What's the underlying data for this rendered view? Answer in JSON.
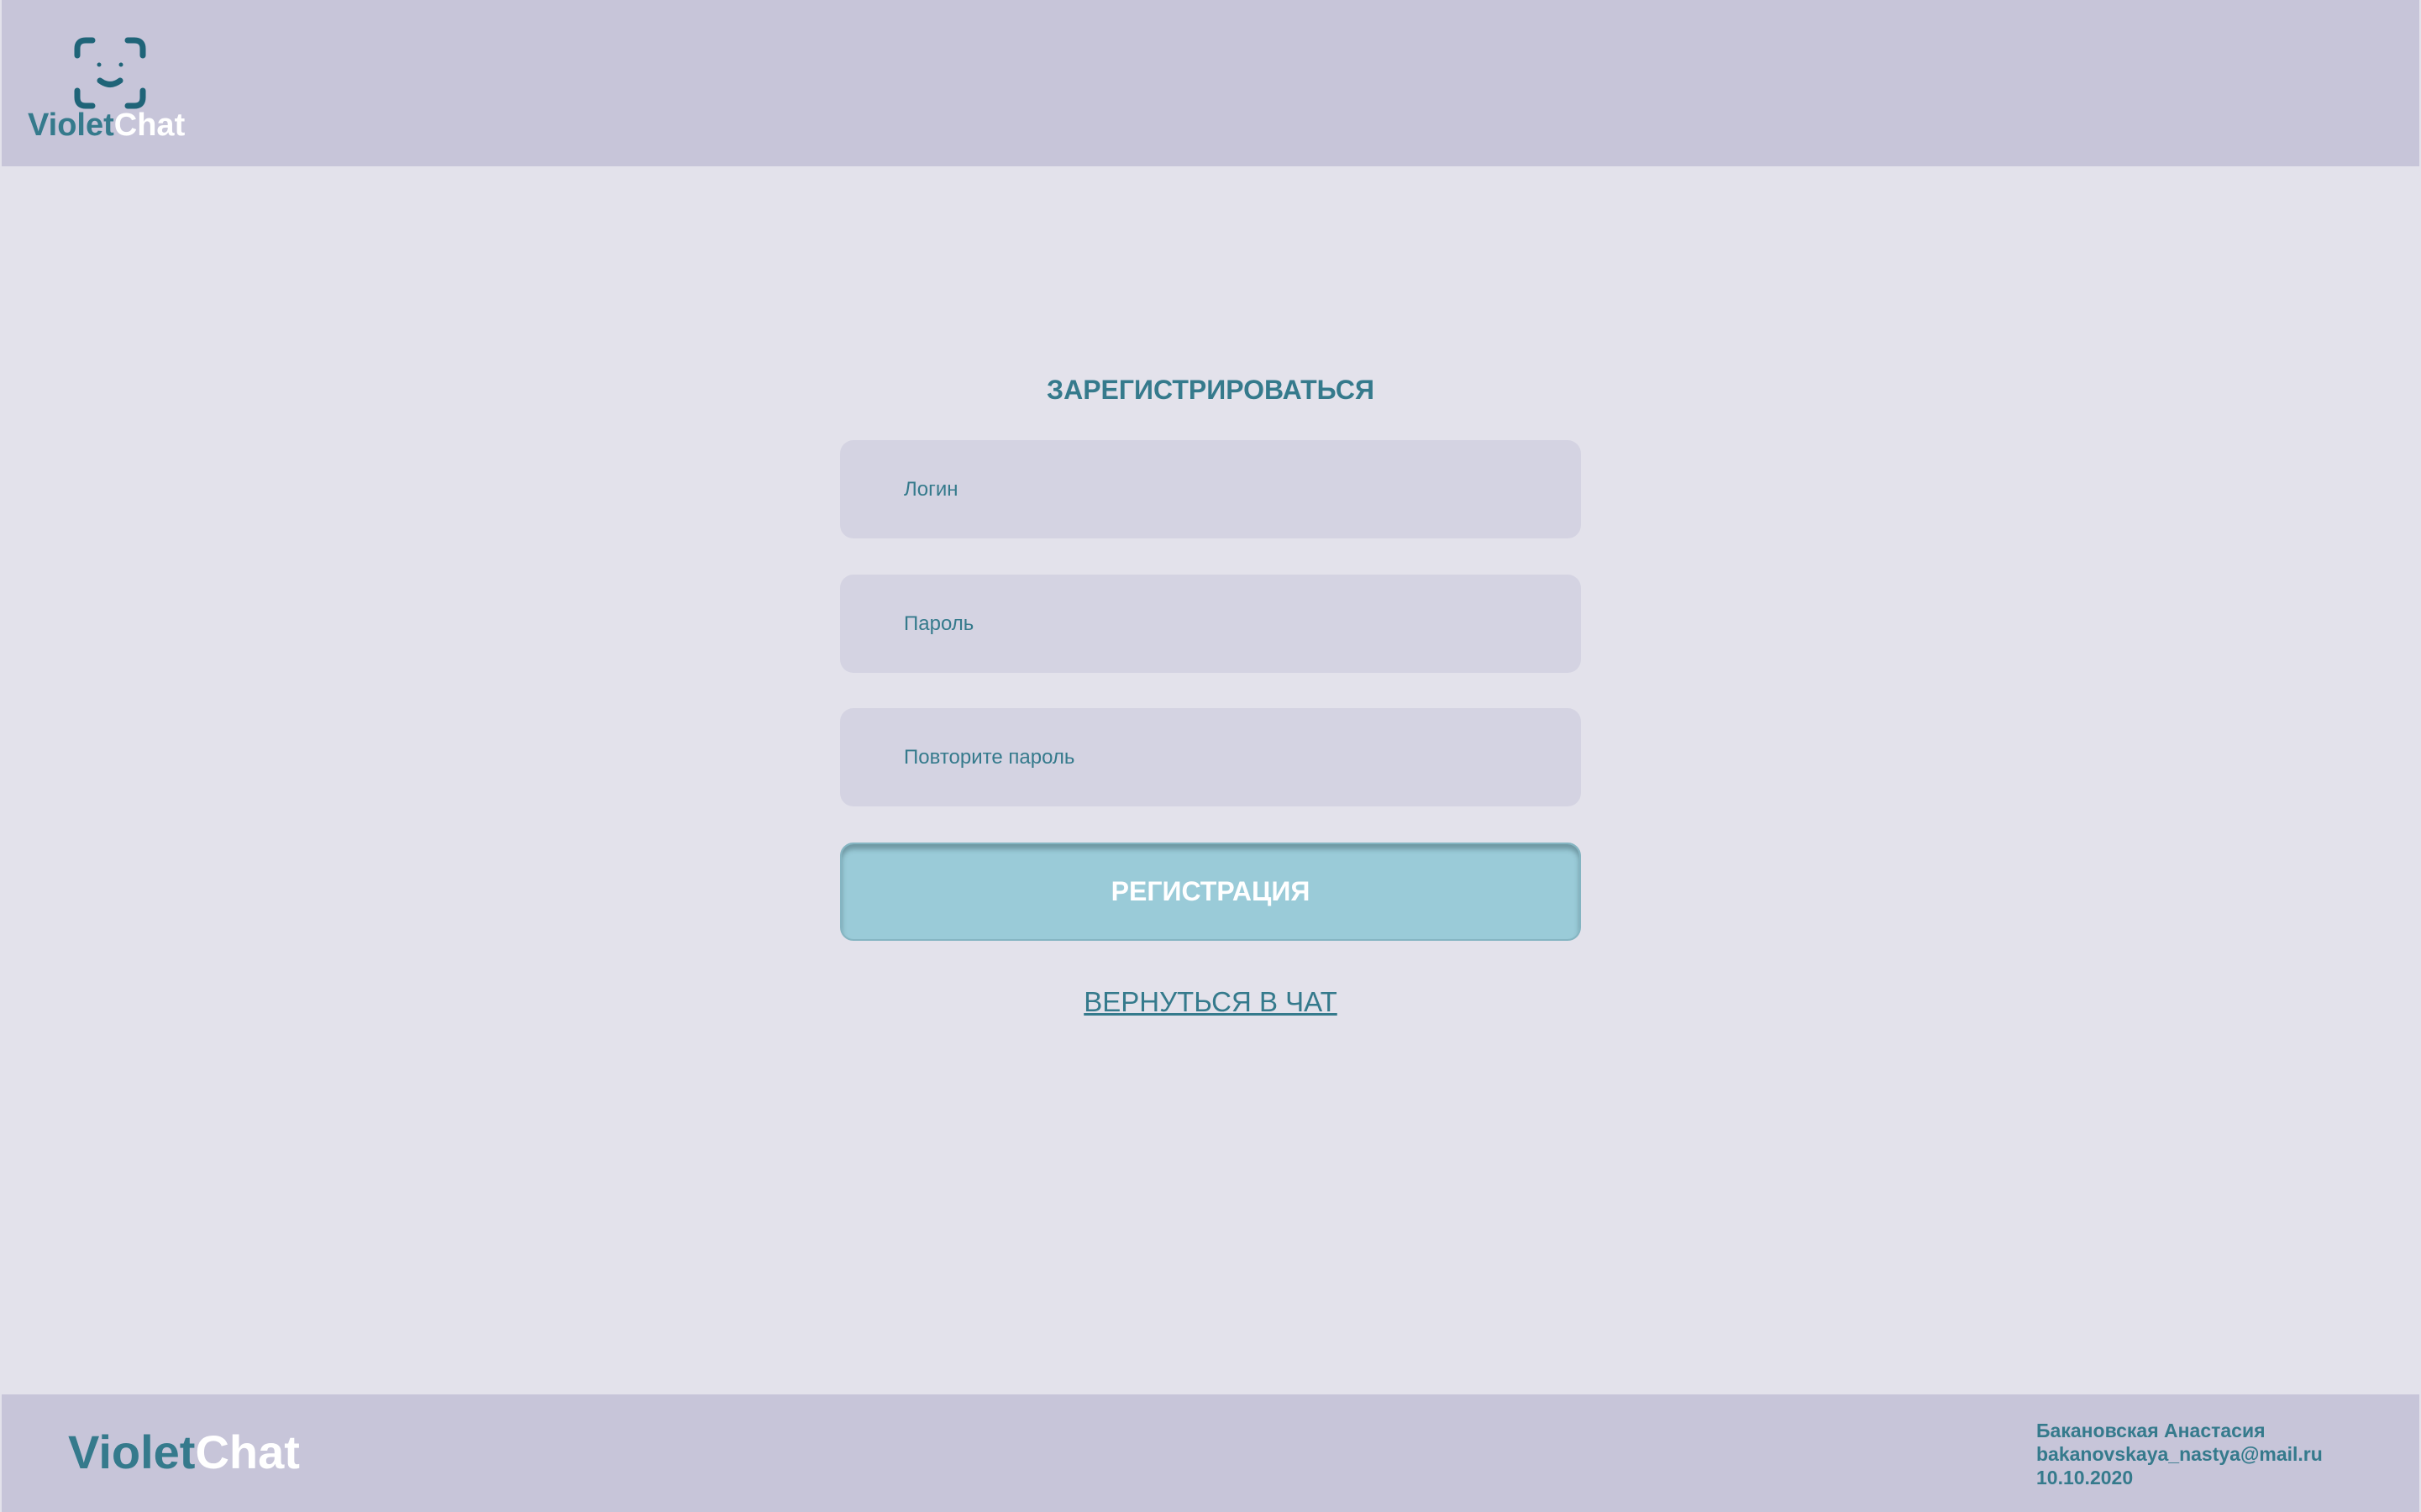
{
  "colors": {
    "header_bg": "#c7c5d9",
    "page_bg": "#e3e2eb",
    "field_bg": "#d4d3e2",
    "accent": "#357a8c",
    "button_bg": "#9acbd8",
    "white": "#ffffff"
  },
  "header": {
    "logo_icon": "face-scan-icon",
    "logo_violet": "Violet",
    "logo_chat": "Chat"
  },
  "form": {
    "title": "ЗАРЕГИСТРИРОВАТЬСЯ",
    "login_placeholder": "Логин",
    "login_value": "",
    "password_placeholder": "Пароль",
    "password_value": "",
    "repeat_password_placeholder": "Повторите пароль",
    "repeat_password_value": "",
    "submit_label": "РЕГИСТРАЦИЯ",
    "back_link_label": "ВЕРНУТЬСЯ В ЧАТ"
  },
  "footer": {
    "logo_violet": "Violet",
    "logo_chat": "Chat",
    "author_name": "Бакановская Анастасия",
    "author_email": "bakanovskaya_nastya@mail.ru",
    "date": "10.10.2020"
  }
}
